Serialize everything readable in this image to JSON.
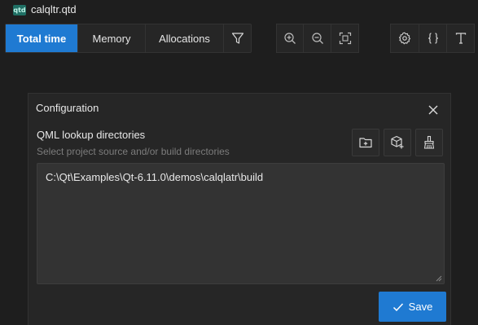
{
  "titlebar": {
    "file_icon_label": "qtd",
    "file_name": "calqltr.qtd"
  },
  "toolbar": {
    "tabs": [
      {
        "label": "Total time",
        "active": true
      },
      {
        "label": "Memory",
        "active": false
      },
      {
        "label": "Allocations",
        "active": false
      }
    ],
    "filter_icon": "filter-icon",
    "zoom_icons": [
      "zoom-in-icon",
      "zoom-out-icon",
      "zoom-fit-icon"
    ],
    "right_icons": [
      "settings-icon",
      "braces-icon",
      "text-icon"
    ]
  },
  "dialog": {
    "title": "Configuration",
    "section_label": "QML lookup directories",
    "section_subtitle": "Select project source and/or build directories",
    "action_icons": [
      "add-folder-icon",
      "add-package-icon",
      "clear-icon"
    ],
    "directories_text": "C:\\Qt\\Examples\\Qt-6.11.0\\demos\\calqlatr\\build",
    "save_label": "Save"
  },
  "colors": {
    "background": "#1e1e1e",
    "panel": "#262626",
    "accent": "#1f7ad2",
    "textarea": "#333333",
    "muted_text": "#7c7c7c"
  }
}
